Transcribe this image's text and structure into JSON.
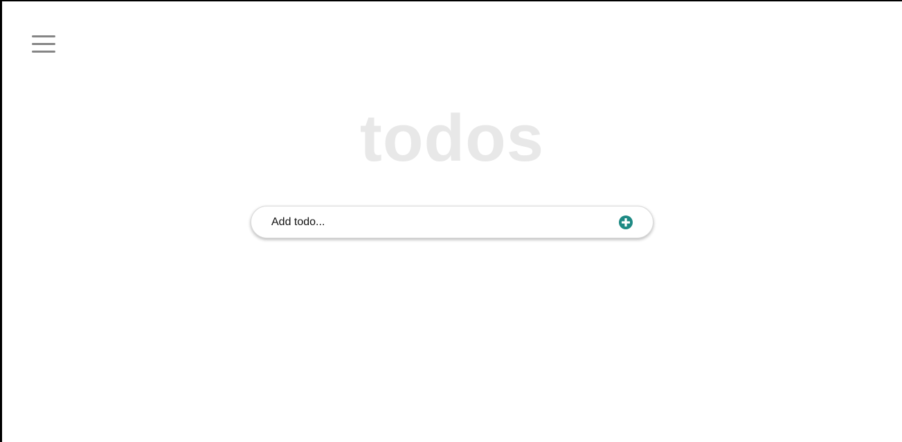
{
  "header": {
    "menu_icon": "hamburger-menu-icon",
    "title": "todos"
  },
  "todo_form": {
    "input_value": "",
    "placeholder": "Add todo...",
    "add_icon": "plus-circle-icon"
  },
  "colors": {
    "accent": "#1e8a84",
    "title": "#e8e8e8",
    "menu_icon": "#858585"
  }
}
